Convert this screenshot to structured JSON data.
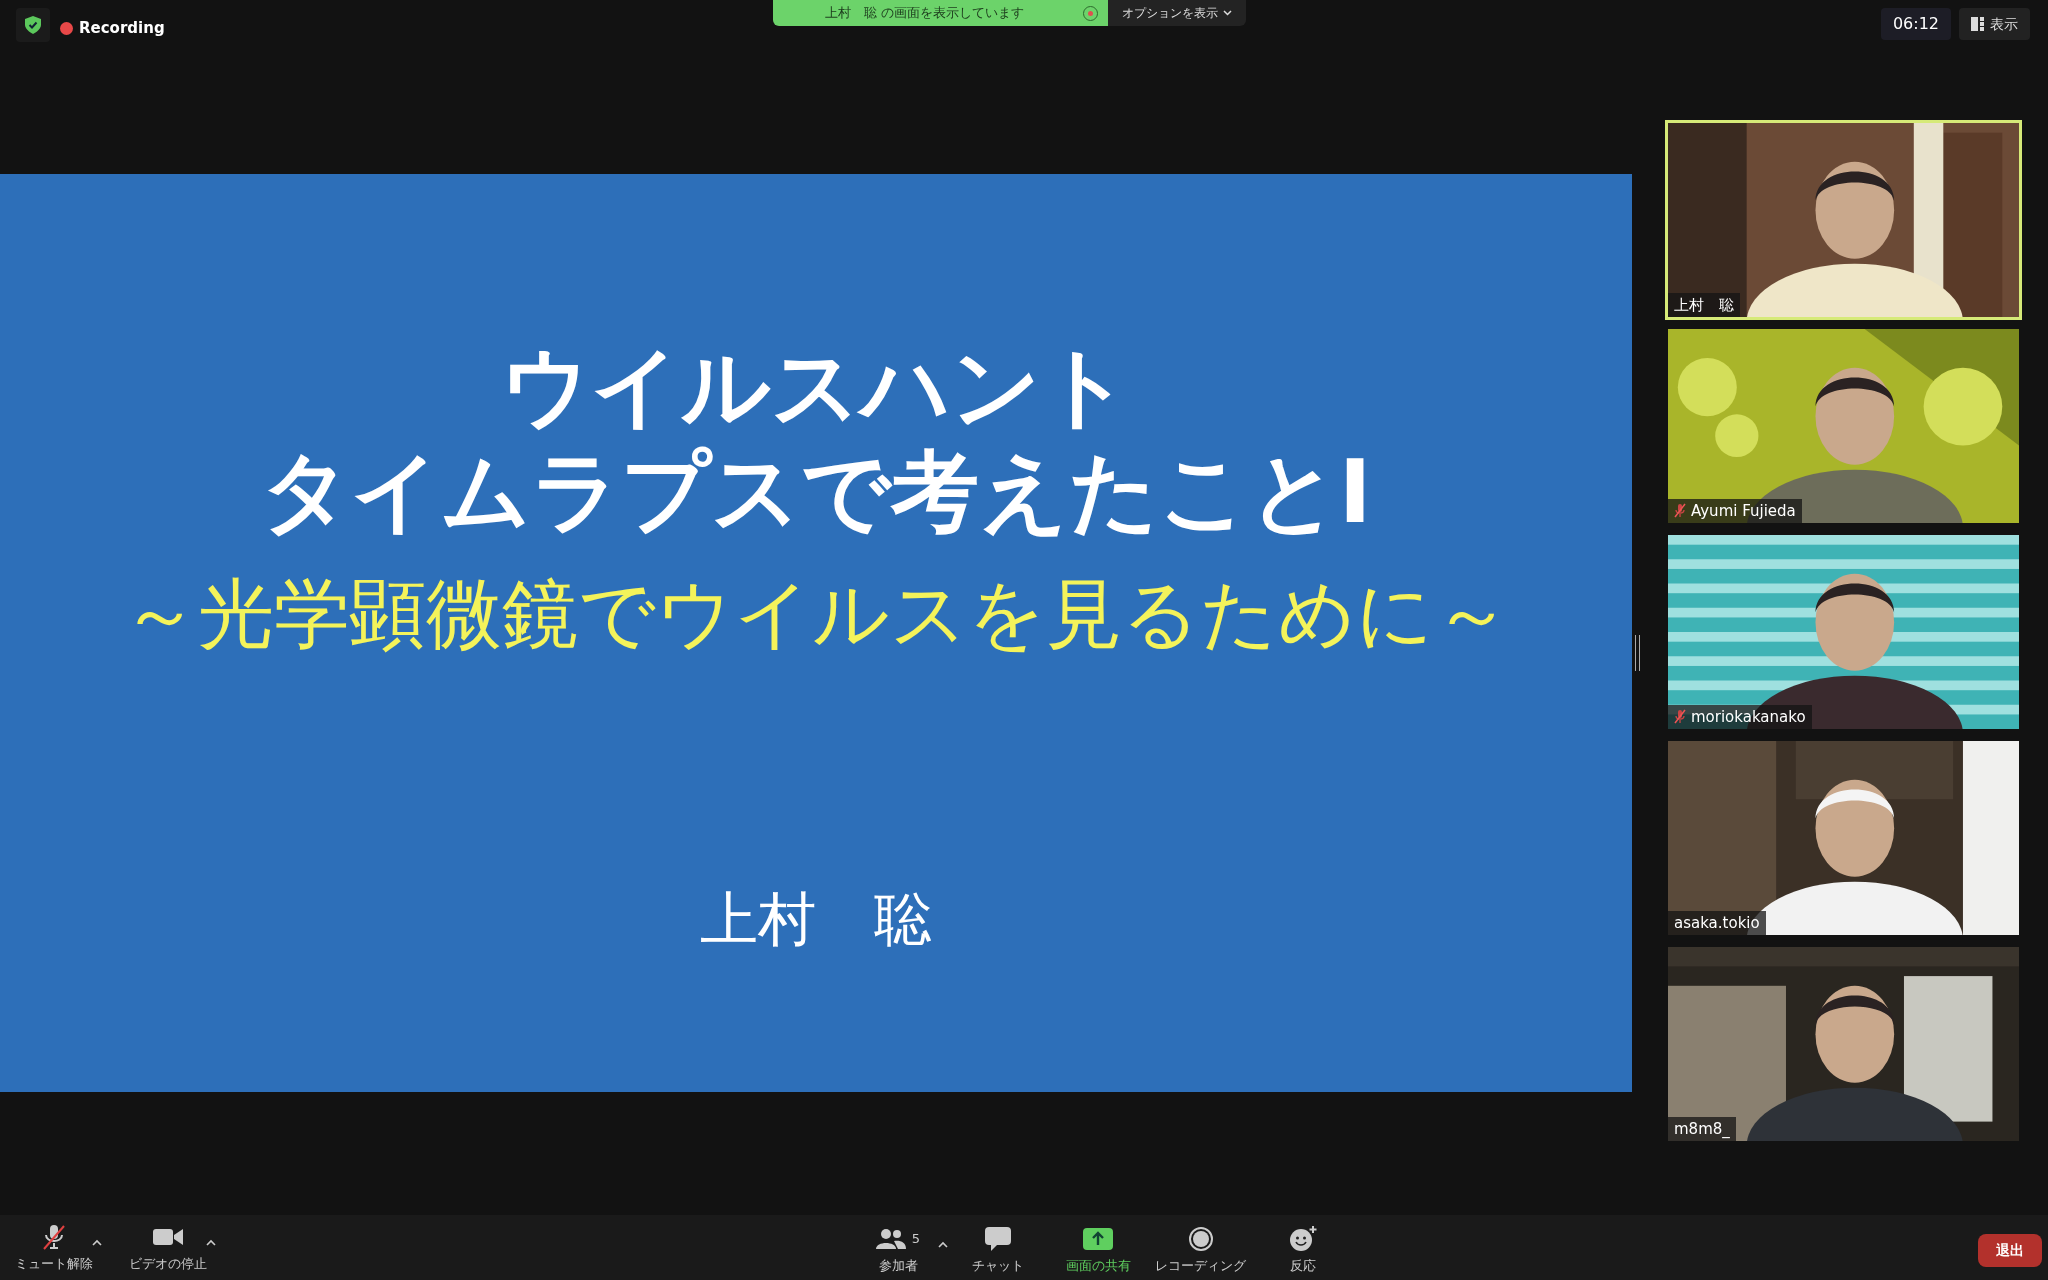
{
  "top_bar": {
    "recording_label": "Recording",
    "share_banner": "上村　聡 の画面を表示しています",
    "options_button": "オプションを表示",
    "timer": "06:12",
    "view_button": "表示"
  },
  "slide": {
    "title_lines": [
      "ウイルスハント",
      "タイムラプスで考えたことⅠ"
    ],
    "subtitle": "～光学顕微鏡でウイルスを見るために～",
    "author": "上村　聡"
  },
  "participants": [
    {
      "name": "上村　聡",
      "muted": false,
      "selected": true
    },
    {
      "name": "Ayumi Fujieda",
      "muted": true,
      "selected": false
    },
    {
      "name": "moriokakanako",
      "muted": true,
      "selected": false
    },
    {
      "name": "asaka.tokio",
      "muted": false,
      "selected": false
    },
    {
      "name": "m8m8_",
      "muted": false,
      "selected": false
    }
  ],
  "toolbar": {
    "left": [
      {
        "kind": "mic",
        "label": "ミュート解除",
        "muted": true
      },
      {
        "kind": "video",
        "label": "ビデオの停止"
      }
    ],
    "center": [
      {
        "kind": "participants",
        "label": "参加者",
        "count": "5"
      },
      {
        "kind": "chat",
        "label": "チャット"
      },
      {
        "kind": "share",
        "label": "画面の共有"
      },
      {
        "kind": "record",
        "label": "レコーディング"
      },
      {
        "kind": "reaction",
        "label": "反応"
      }
    ],
    "leave_button": "退出"
  }
}
